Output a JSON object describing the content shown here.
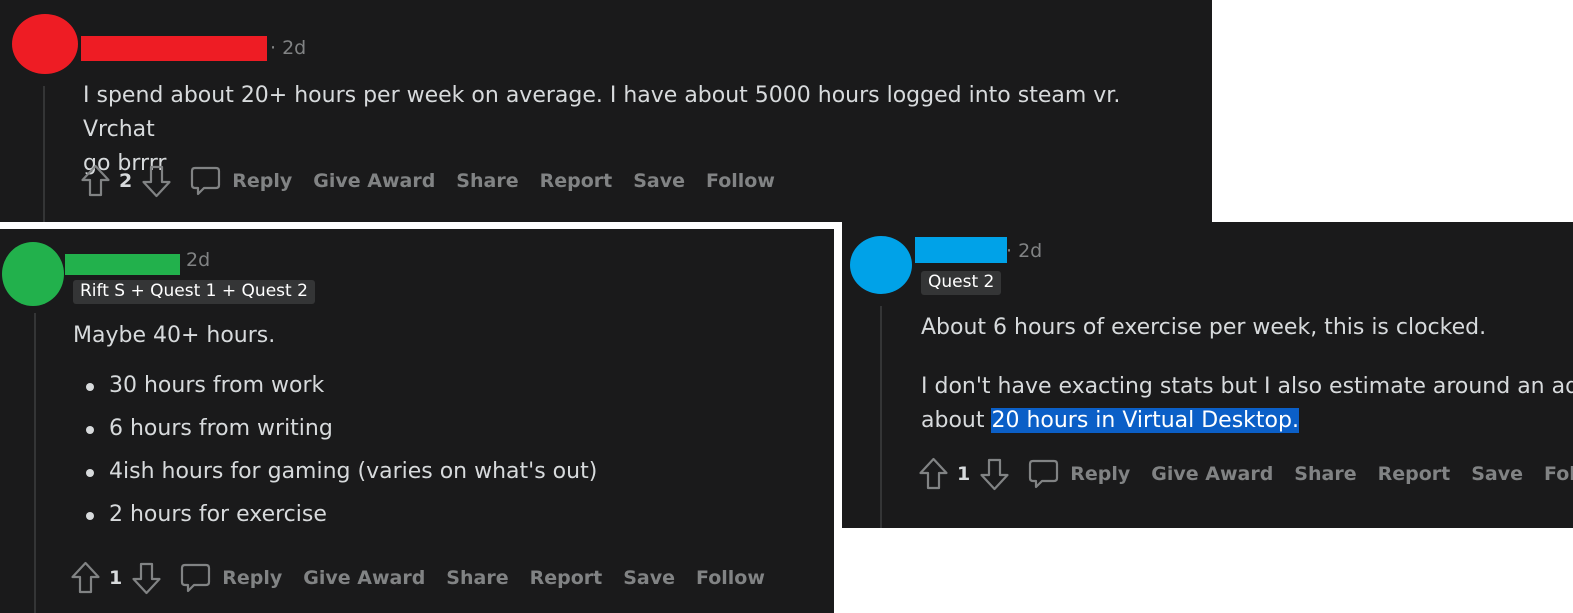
{
  "colors": {
    "panel_bg": "#1a1a1b",
    "text": "#d7dadc",
    "muted": "#818384",
    "flair_bg": "#343536",
    "highlight": "#0b5fc7",
    "avatar_red": "#ee1c24",
    "avatar_green": "#22b14c",
    "avatar_blue": "#00a2e8"
  },
  "actions": {
    "reply": "Reply",
    "give_award": "Give Award",
    "share": "Share",
    "report": "Report",
    "save": "Save",
    "follow": "Follow"
  },
  "comments": [
    {
      "time": "· 2d",
      "body": [
        "I spend about 20+ hours per week on average. I have about 5000 hours logged into steam vr. Vrchat",
        "go brrrr"
      ],
      "votes": "2"
    },
    {
      "time": "2d",
      "flair": "Rift S + Quest 1 + Quest 2",
      "intro": "Maybe 40+ hours.",
      "bullets": [
        "30 hours from work",
        "6 hours from writing",
        "4ish hours for gaming (varies on what's out)",
        "2 hours for exercise"
      ],
      "votes": "1"
    },
    {
      "time": "· 2d",
      "flair": "Quest 2",
      "para1": "About 6 hours of exercise per week, this is clocked.",
      "para2_line1": "I don't have exacting stats but I also estimate around an additional",
      "para2_line2_start": "about ",
      "para2_line2_highlight": "20 hours in Virtual Desktop.",
      "votes": "1"
    }
  ]
}
